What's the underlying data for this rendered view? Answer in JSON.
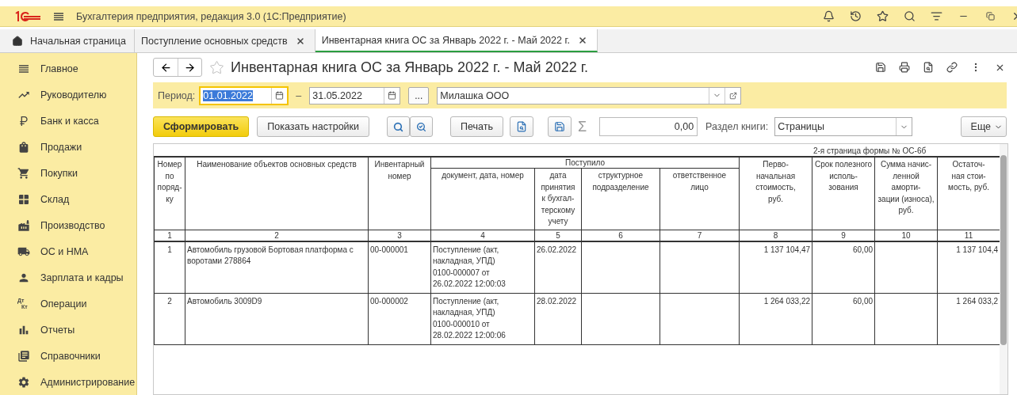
{
  "app_bar": {
    "title": "Бухгалтерия предприятия, редакция 3.0  (1С:Предприятие)"
  },
  "tabs": [
    {
      "label": "Начальная страница",
      "kind": "home",
      "selected": false
    },
    {
      "label": "Поступление основных средств",
      "kind": "doc",
      "selected": false
    },
    {
      "label": "Инвентарная книга ОС за Январь 2022 г. - Май 2022 г.",
      "kind": "doc",
      "selected": true
    }
  ],
  "sidebar": {
    "items": [
      {
        "label": "Главное"
      },
      {
        "label": "Руководителю"
      },
      {
        "label": "Банк и касса"
      },
      {
        "label": "Продажи"
      },
      {
        "label": "Покупки"
      },
      {
        "label": "Склад"
      },
      {
        "label": "Производство"
      },
      {
        "label": "ОС и НМА"
      },
      {
        "label": "Зарплата и кадры"
      },
      {
        "label": "Операции",
        "icon_text": [
          "Дт",
          "Кт"
        ]
      },
      {
        "label": "Отчеты"
      },
      {
        "label": "Справочники"
      },
      {
        "label": "Администрирование"
      }
    ]
  },
  "report": {
    "title": "Инвентарная книга ОС за Январь 2022 г. - Май 2022 г.",
    "period_label": "Период:",
    "period_start": {
      "value": "01.01.2022",
      "focused": true,
      "text_selected": true
    },
    "period_dash": "–",
    "period_end": {
      "value": "31.05.2022",
      "focused": false,
      "text_selected": false
    },
    "period_more": "...",
    "organization": "Милашка ООО",
    "buttons": {
      "generate": "Сформировать",
      "settings": "Показать настройки",
      "print": "Печать",
      "more": "Еще"
    },
    "sum_sign": "Σ",
    "sum_value": "0,00",
    "section_label": "Раздел книги:",
    "section_value": "Страницы"
  },
  "table": {
    "caption": "2-я страница формы № ОС-6б",
    "group_header": "Поступило",
    "columns": [
      {
        "label": "Номер\nпо\nпоряд-\nку",
        "kind": "plain"
      },
      {
        "label": "Наименование объектов основных средств",
        "kind": "plain"
      },
      {
        "label": "Инвентарный\nномер",
        "kind": "plain"
      },
      {
        "label": "документ, дата, номер",
        "kind": "grouped"
      },
      {
        "label": "дата\nпринятия\nк бухгал-\nтерскому\nучету",
        "kind": "grouped"
      },
      {
        "label": "структурное\nподразделение",
        "kind": "grouped"
      },
      {
        "label": "ответственное\nлицо",
        "kind": "grouped"
      },
      {
        "label": "Перво-\nначальная\nстоимость,\nруб.",
        "kind": "plain"
      },
      {
        "label": "Срок полезного\nисполь-\nзования",
        "kind": "plain"
      },
      {
        "label": "Сумма начис-\nленной\nаморти-\nзации (износа),\nруб.",
        "kind": "plain"
      },
      {
        "label": "Остаточ-\nная стои-\nмость, руб.",
        "kind": "plain"
      }
    ],
    "numbers": [
      "1",
      "2",
      "3",
      "4",
      "5",
      "6",
      "7",
      "8",
      "9",
      "10",
      "11"
    ],
    "rows": [
      [
        "1",
        "Автомобиль грузовой Бортовая платформа с воротами 278864",
        "00-000001",
        "Поступление (акт,\nнакладная, УПД)\n0100-000007 от\n26.02.2022 12:00:03",
        "26.02.2022",
        "",
        "",
        "1 137 104,47",
        "60,00",
        "",
        "1 137 104,4"
      ],
      [
        "2",
        "Автомобиль 3009D9",
        "00-000002",
        "Поступление (акт,\nнакладная, УПД)\n0100-000010 от\n28.02.2022 12:00:06",
        "28.02.2022",
        "",
        "",
        "1 264 033,22",
        "60,00",
        "",
        "1 264 033,2"
      ]
    ]
  }
}
